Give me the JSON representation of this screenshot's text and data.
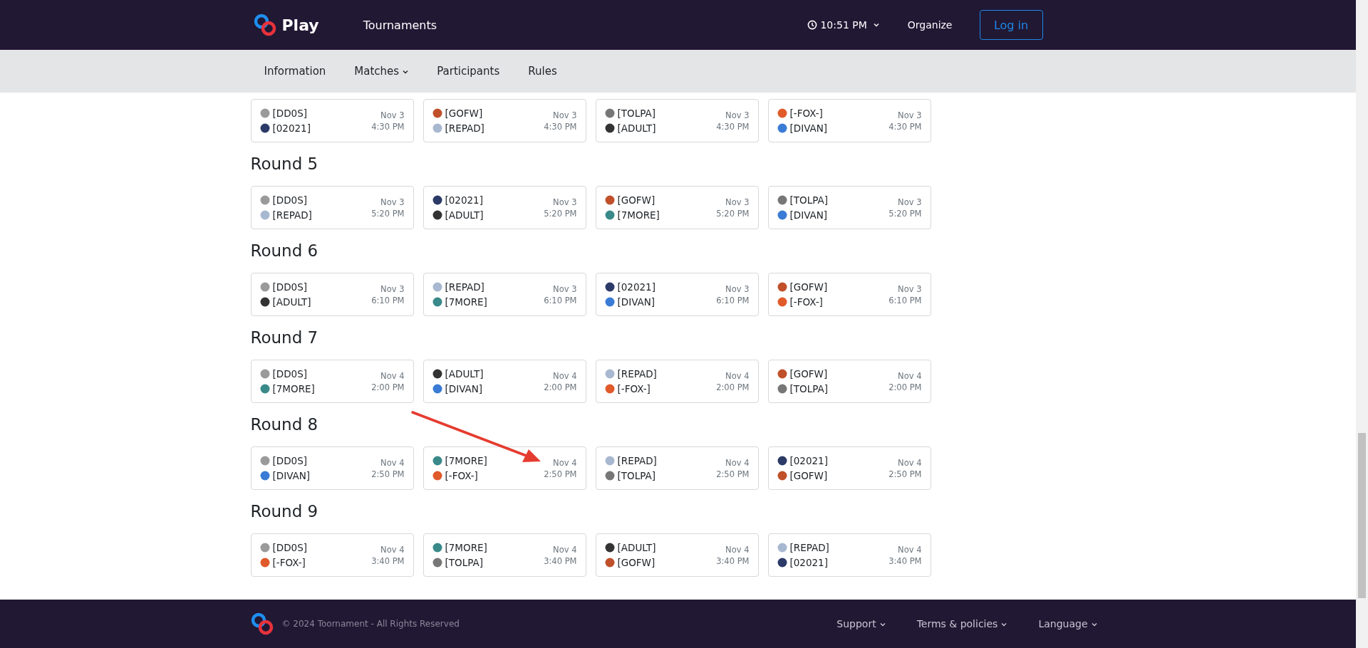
{
  "header": {
    "brand": "Play",
    "nav": [
      {
        "label": "Tournaments"
      }
    ],
    "time": "10:51 PM",
    "links": [
      {
        "label": "Organize"
      }
    ],
    "login": "Log in"
  },
  "subnav": [
    {
      "label": "Information",
      "dropdown": false
    },
    {
      "label": "Matches",
      "dropdown": true
    },
    {
      "label": "Participants",
      "dropdown": false
    },
    {
      "label": "Rules",
      "dropdown": false
    }
  ],
  "rounds": [
    {
      "matches": [
        {
          "teams": [
            {
              "name": "[DD0S]",
              "color": "#9a9a9a"
            },
            {
              "name": "[02021]",
              "color": "#2b3a67"
            }
          ],
          "date": "Nov 3",
          "time": "4:30 PM"
        },
        {
          "teams": [
            {
              "name": "[GOFW]",
              "color": "#c0502a"
            },
            {
              "name": "[REPAD]",
              "color": "#a8b8d0"
            }
          ],
          "date": "Nov 3",
          "time": "4:30 PM"
        },
        {
          "teams": [
            {
              "name": "[TOLPA]",
              "color": "#777777"
            },
            {
              "name": "[ADULT]",
              "color": "#333333"
            }
          ],
          "date": "Nov 3",
          "time": "4:30 PM"
        },
        {
          "teams": [
            {
              "name": "[-FOX-]",
              "color": "#e05a2a"
            },
            {
              "name": "[DIVAN]",
              "color": "#3a7bd5"
            }
          ],
          "date": "Nov 3",
          "time": "4:30 PM"
        }
      ]
    },
    {
      "title": "Round 5",
      "matches": [
        {
          "teams": [
            {
              "name": "[DD0S]",
              "color": "#9a9a9a"
            },
            {
              "name": "[REPAD]",
              "color": "#a8b8d0"
            }
          ],
          "date": "Nov 3",
          "time": "5:20 PM"
        },
        {
          "teams": [
            {
              "name": "[02021]",
              "color": "#2b3a67"
            },
            {
              "name": "[ADULT]",
              "color": "#333333"
            }
          ],
          "date": "Nov 3",
          "time": "5:20 PM"
        },
        {
          "teams": [
            {
              "name": "[GOFW]",
              "color": "#c0502a"
            },
            {
              "name": "[7MORE]",
              "color": "#3a8a8a"
            }
          ],
          "date": "Nov 3",
          "time": "5:20 PM"
        },
        {
          "teams": [
            {
              "name": "[TOLPA]",
              "color": "#777777"
            },
            {
              "name": "[DIVAN]",
              "color": "#3a7bd5"
            }
          ],
          "date": "Nov 3",
          "time": "5:20 PM"
        }
      ]
    },
    {
      "title": "Round 6",
      "matches": [
        {
          "teams": [
            {
              "name": "[DD0S]",
              "color": "#9a9a9a"
            },
            {
              "name": "[ADULT]",
              "color": "#333333"
            }
          ],
          "date": "Nov 3",
          "time": "6:10 PM"
        },
        {
          "teams": [
            {
              "name": "[REPAD]",
              "color": "#a8b8d0"
            },
            {
              "name": "[7MORE]",
              "color": "#3a8a8a"
            }
          ],
          "date": "Nov 3",
          "time": "6:10 PM"
        },
        {
          "teams": [
            {
              "name": "[02021]",
              "color": "#2b3a67"
            },
            {
              "name": "[DIVAN]",
              "color": "#3a7bd5"
            }
          ],
          "date": "Nov 3",
          "time": "6:10 PM"
        },
        {
          "teams": [
            {
              "name": "[GOFW]",
              "color": "#c0502a"
            },
            {
              "name": "[-FOX-]",
              "color": "#e05a2a"
            }
          ],
          "date": "Nov 3",
          "time": "6:10 PM"
        }
      ]
    },
    {
      "title": "Round 7",
      "matches": [
        {
          "teams": [
            {
              "name": "[DD0S]",
              "color": "#9a9a9a"
            },
            {
              "name": "[7MORE]",
              "color": "#3a8a8a"
            }
          ],
          "date": "Nov 4",
          "time": "2:00 PM"
        },
        {
          "teams": [
            {
              "name": "[ADULT]",
              "color": "#333333"
            },
            {
              "name": "[DIVAN]",
              "color": "#3a7bd5"
            }
          ],
          "date": "Nov 4",
          "time": "2:00 PM"
        },
        {
          "teams": [
            {
              "name": "[REPAD]",
              "color": "#a8b8d0"
            },
            {
              "name": "[-FOX-]",
              "color": "#e05a2a"
            }
          ],
          "date": "Nov 4",
          "time": "2:00 PM"
        },
        {
          "teams": [
            {
              "name": "[GOFW]",
              "color": "#c0502a"
            },
            {
              "name": "[TOLPA]",
              "color": "#777777"
            }
          ],
          "date": "Nov 4",
          "time": "2:00 PM"
        }
      ]
    },
    {
      "title": "Round 8",
      "matches": [
        {
          "teams": [
            {
              "name": "[DD0S]",
              "color": "#9a9a9a"
            },
            {
              "name": "[DIVAN]",
              "color": "#3a7bd5"
            }
          ],
          "date": "Nov 4",
          "time": "2:50 PM"
        },
        {
          "teams": [
            {
              "name": "[7MORE]",
              "color": "#3a8a8a"
            },
            {
              "name": "[-FOX-]",
              "color": "#e05a2a"
            }
          ],
          "date": "Nov 4",
          "time": "2:50 PM"
        },
        {
          "teams": [
            {
              "name": "[REPAD]",
              "color": "#a8b8d0"
            },
            {
              "name": "[TOLPA]",
              "color": "#777777"
            }
          ],
          "date": "Nov 4",
          "time": "2:50 PM"
        },
        {
          "teams": [
            {
              "name": "[02021]",
              "color": "#2b3a67"
            },
            {
              "name": "[GOFW]",
              "color": "#c0502a"
            }
          ],
          "date": "Nov 4",
          "time": "2:50 PM"
        }
      ]
    },
    {
      "title": "Round 9",
      "matches": [
        {
          "teams": [
            {
              "name": "[DD0S]",
              "color": "#9a9a9a"
            },
            {
              "name": "[-FOX-]",
              "color": "#e05a2a"
            }
          ],
          "date": "Nov 4",
          "time": "3:40 PM"
        },
        {
          "teams": [
            {
              "name": "[7MORE]",
              "color": "#3a8a8a"
            },
            {
              "name": "[TOLPA]",
              "color": "#777777"
            }
          ],
          "date": "Nov 4",
          "time": "3:40 PM"
        },
        {
          "teams": [
            {
              "name": "[ADULT]",
              "color": "#333333"
            },
            {
              "name": "[GOFW]",
              "color": "#c0502a"
            }
          ],
          "date": "Nov 4",
          "time": "3:40 PM"
        },
        {
          "teams": [
            {
              "name": "[REPAD]",
              "color": "#a8b8d0"
            },
            {
              "name": "[02021]",
              "color": "#2b3a67"
            }
          ],
          "date": "Nov 4",
          "time": "3:40 PM"
        }
      ]
    }
  ],
  "footer": {
    "copyright": "© 2024 Toornament - All Rights Reserved",
    "links": [
      {
        "label": "Support",
        "dropdown": true
      },
      {
        "label": "Terms & policies",
        "dropdown": true
      },
      {
        "label": "Language",
        "dropdown": true
      }
    ]
  }
}
